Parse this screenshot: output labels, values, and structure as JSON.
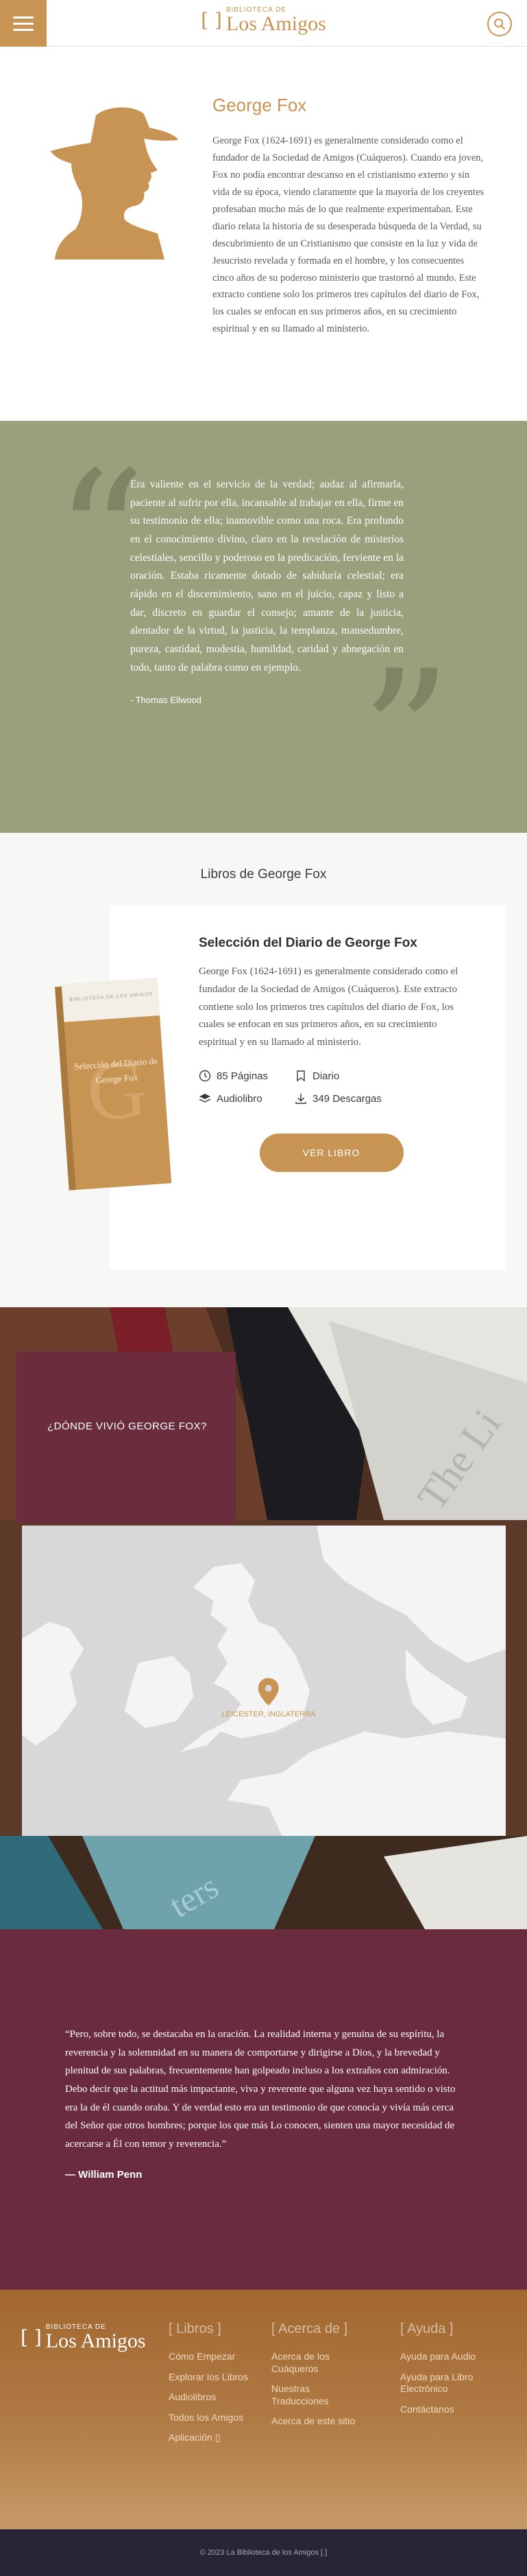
{
  "header": {
    "logo_small": "BIBLIOTECA DE",
    "logo_big": "Los Amigos",
    "logo_mark": "[ ]"
  },
  "author": {
    "name": "George Fox",
    "bio": "George Fox (1624-1691) es generalmente considerado como el fundador de la Sociedad de Amigos (Cuáqueros). Cuando era joven, Fox no podía encontrar descanso en el cristianismo externo y sin vida de su época, viendo claramente que la mayoría de los creyentes profesaban mucho más de lo que realmente experimentaban. Este diario relata la historia de su desesperada búsqueda de la Verdad, su descubrimiento de un Cristianismo que consiste en la luz y vida de Jesucristo revelada y formada en el hombre, y los consecuentes cinco años de su poderoso ministerio que trastornó al mundo. Este extracto contiene solo los primeros tres capítulos del diario de Fox, los cuales se enfocan en sus primeros años, en su crecimiento espiritual y en su llamado al ministerio."
  },
  "quote": {
    "text": "Era valiente en el servicio de la verdad; audaz al afirmarla, paciente al sufrir por ella, incansable al trabajar en ella, firme en su testimonio de ella; inamovible como una roca. Era profundo en el conocimiento divino, claro en la revelación de misterios celestiales, sencillo y poderoso en la predicación, ferviente en la oración. Estaba ricamente dotado de sabiduría celestial; era rápido en el discernimiento, sano en el juicio, capaz y listo a dar, discreto en guardar el consejo; amante de la justicia, alentador de la virtud, la justicia, la templanza, mansedumbre, pureza, castidad, modestia, humildad, caridad y abnegación en todo, tanto de palabra como en ejemplo.",
    "author": "- Thomas Ellwood"
  },
  "books": {
    "heading": "Libros de George Fox",
    "items": [
      {
        "title": "Selección del Diario de George Fox",
        "description": "George Fox (1624-1691) es generalmente considerado como el fundador de la Sociedad de Amigos (Cuáqueros). Este extracto contiene solo los primeros tres capítulos del diario de Fox, los cuales se enfocan en sus primeros años, en su crecimiento espiritual y en su llamado al ministerio.",
        "pages": "85 Páginas",
        "category": "Diario",
        "format": "Audiolibro",
        "downloads": "349 Descargas",
        "button": "VER LIBRO",
        "cover_series": "BIBLIOTECA DE LOS AMIGOS",
        "cover_title": "Selección del Diario de George Fox"
      }
    ]
  },
  "where": {
    "heading": "¿DÓNDE VIVIÓ GEORGE FOX?",
    "location": "LEICESTER, INGLATERRA"
  },
  "penn": {
    "text": "“Pero, sobre todo, se destacaba en la oración. La realidad interna y genuina de su espíritu, la reverencia y la solemnidad en su manera de comportarse y dirigirse a Dios, y la brevedad y plenitud de sus palabras, frecuentemente han golpeado incluso a los extraños con admiración. Debo decir que la actitud más impactante, viva y reverente que alguna vez haya sentido o visto era la de él cuando oraba. Y de verdad esto era un testimonio de que conocía y vivía más cerca del Señor que otros hombres; porque los que más Lo conocen, sienten una mayor necesidad de acercarse a Él con temor y reverencia.”",
    "author": "— William Penn"
  },
  "footer": {
    "logo_small": "BIBLIOTECA DE",
    "logo_big": "Los Amigos",
    "columns": [
      {
        "heading": "[ Libros ]",
        "links": [
          "Cómo Empezar",
          "Explorar los Libros",
          "Audiolibros",
          "Todos los Amigos",
          "Aplicación"
        ]
      },
      {
        "heading": "[ Acerca de ]",
        "links": [
          "Acerca de los Cuáqueros",
          "Nuestras Traducciones",
          "Acerca de este sitio"
        ]
      },
      {
        "heading": "[ Ayuda ]",
        "links": [
          "Ayuda para Audio",
          "Ayuda para Libro Electrónico",
          "Contáctanos"
        ]
      }
    ],
    "copyright": "© 2023 La Biblioteca de los Amigos [.]"
  },
  "colors": {
    "accent": "#c79454",
    "olive": "#9a9f7c",
    "maroon": "#6a2b3e",
    "footer_bar": "#2a2536"
  }
}
